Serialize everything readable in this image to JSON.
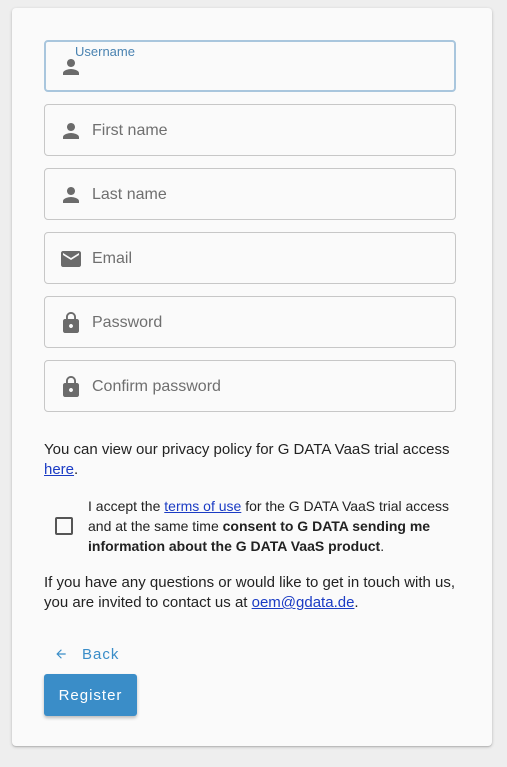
{
  "form": {
    "fields": [
      {
        "key": "username",
        "label": "Username",
        "placeholder": "",
        "icon": "person-icon",
        "focused": true
      },
      {
        "key": "first_name",
        "placeholder": "First name",
        "icon": "person-icon"
      },
      {
        "key": "last_name",
        "placeholder": "Last name",
        "icon": "person-icon"
      },
      {
        "key": "email",
        "placeholder": "Email",
        "icon": "mail-icon"
      },
      {
        "key": "password",
        "placeholder": "Password",
        "icon": "lock-icon"
      },
      {
        "key": "confirm_password",
        "placeholder": "Confirm password",
        "icon": "lock-icon"
      }
    ]
  },
  "privacy": {
    "text": "You can view our privacy policy for G DATA VaaS trial access ",
    "link": "here",
    "suffix": "."
  },
  "consent": {
    "checked": false,
    "text_before": "I accept the ",
    "terms_link": "terms of use",
    "text_middle": " for the G DATA VaaS trial access and at the same time ",
    "bold_text": "consent to G DATA sending me information about the G DATA VaaS product",
    "text_after": "."
  },
  "contact": {
    "text": "If you have any questions or would like to get in touch with us, you are invited to contact us at ",
    "email": "oem@gdata.de",
    "suffix": "."
  },
  "actions": {
    "back_label": "Back",
    "register_label": "Register"
  },
  "colors": {
    "accent": "#3a8dc8",
    "link": "#1a3bc4",
    "focus_border": "#a9c6dd"
  }
}
